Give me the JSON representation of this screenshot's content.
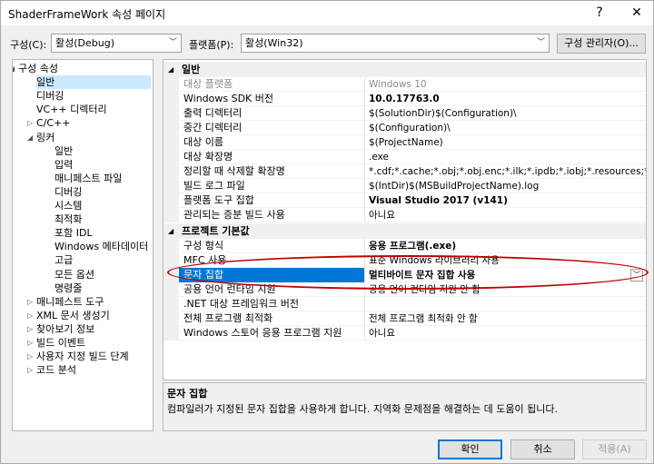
{
  "window": {
    "title": "ShaderFrameWork 속성 페이지",
    "help": "?",
    "close": "✕"
  },
  "config": {
    "config_label": "구성(C):",
    "config_value": "활성(Debug)",
    "platform_label": "플랫폼(P):",
    "platform_value": "활성(Win32)",
    "manager_button": "구성 관리자(O)..."
  },
  "tree": [
    {
      "label": "구성 속성",
      "twisty": "◢"
    },
    {
      "label": "일반",
      "selected": true
    },
    {
      "label": "디버깅"
    },
    {
      "label": "VC++ 디렉터리"
    },
    {
      "label": "C/C++",
      "twisty": "▷"
    },
    {
      "label": "링커",
      "twisty": "◢"
    },
    {
      "label": "일반"
    },
    {
      "label": "입력"
    },
    {
      "label": "매니페스트 파일"
    },
    {
      "label": "디버깅"
    },
    {
      "label": "시스템"
    },
    {
      "label": "최적화"
    },
    {
      "label": "포함 IDL"
    },
    {
      "label": "Windows 메타데이터"
    },
    {
      "label": "고급"
    },
    {
      "label": "모든 옵션"
    },
    {
      "label": "명령줄"
    },
    {
      "label": "매니페스트 도구",
      "twisty": "▷"
    },
    {
      "label": "XML 문서 생성기",
      "twisty": "▷"
    },
    {
      "label": "찾아보기 정보",
      "twisty": "▷"
    },
    {
      "label": "빌드 이벤트",
      "twisty": "▷"
    },
    {
      "label": "사용자 지정 빌드 단계",
      "twisty": "▷"
    },
    {
      "label": "코드 분석",
      "twisty": "▷"
    }
  ],
  "grid": {
    "categories": [
      {
        "caret": "◢",
        "label": "일반"
      },
      {
        "caret": "◢",
        "label": "프로젝트 기본값"
      }
    ],
    "general": [
      {
        "name": "대상 플랫폼",
        "value": "Windows 10",
        "grey": true
      },
      {
        "name": "Windows SDK 버전",
        "value": "10.0.17763.0",
        "bold": true
      },
      {
        "name": "출력 디렉터리",
        "value": "$(SolutionDir)$(Configuration)\\"
      },
      {
        "name": "중간 디렉터리",
        "value": "$(Configuration)\\"
      },
      {
        "name": "대상 이름",
        "value": "$(ProjectName)"
      },
      {
        "name": "대상 확장명",
        "value": ".exe"
      },
      {
        "name": "정리할 때 삭제할 확장명",
        "value": "*.cdf;*.cache;*.obj;*.obj.enc;*.ilk;*.ipdb;*.iobj;*.resources;*.tlb;*.tli;*.tl"
      },
      {
        "name": "빌드 로그 파일",
        "value": "$(IntDir)$(MSBuildProjectName).log"
      },
      {
        "name": "플랫폼 도구 집합",
        "value": "Visual Studio 2017 (v141)",
        "bold": true
      },
      {
        "name": "관리되는 증분 빌드 사용",
        "value": "아니요"
      }
    ],
    "defaults": [
      {
        "name": "구성 형식",
        "value": "응용 프로그램(.exe)",
        "bold": true
      },
      {
        "name": "MFC 사용",
        "value": "표준 Windows 라이브러리 사용"
      },
      {
        "name": "문자 집합",
        "value": "멀티바이트 문자 집합 사용",
        "bold": true,
        "selected": true
      },
      {
        "name": "공용 언어 런타임 지원",
        "value": "공용 언어 런타임 지원 안 함"
      },
      {
        "name": ".NET 대상 프레임워크 버전",
        "value": ""
      },
      {
        "name": "전체 프로그램 최적화",
        "value": "전체 프로그램 최적화 안 함"
      },
      {
        "name": "Windows 스토어 응용 프로그램 지원",
        "value": "아니요"
      }
    ]
  },
  "description": {
    "title": "문자 집합",
    "text": "컴파일러가 지정된 문자 집합을 사용하게 합니다. 지역화 문제점을 해결하는 데 도움이 됩니다."
  },
  "buttons": {
    "ok": "확인",
    "cancel": "취소",
    "apply": "적용(A)"
  },
  "colors": {
    "selection": "#0078d7",
    "tree_selection": "#cce8ff",
    "annotation": "#c00000"
  }
}
